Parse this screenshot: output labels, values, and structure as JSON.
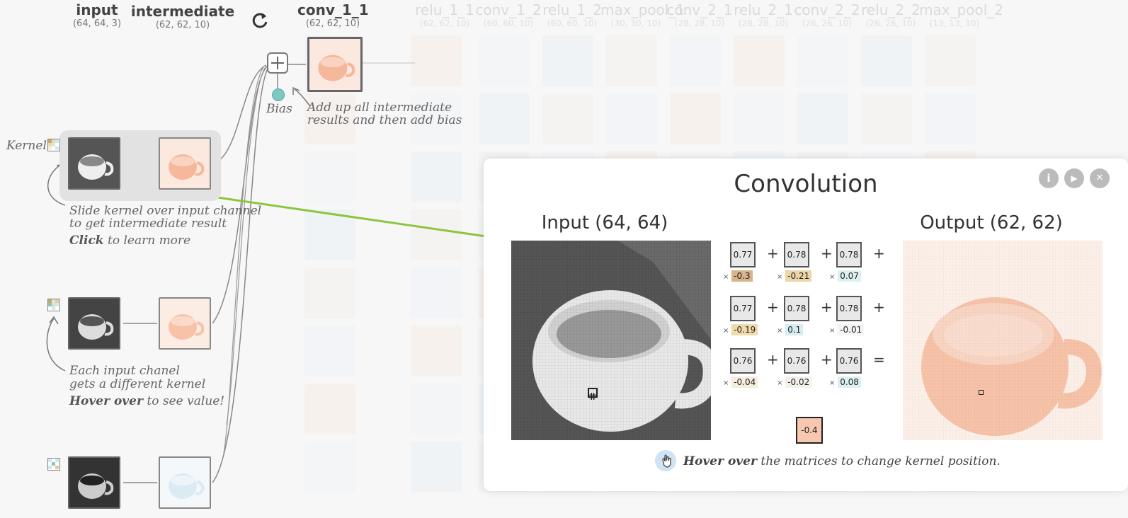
{
  "columns": {
    "input": {
      "name": "input",
      "shape": "(64, 64, 3)"
    },
    "intermediate": {
      "name": "intermediate",
      "shape": "(62, 62, 10)"
    },
    "conv_1_1": {
      "name": "conv_1_1",
      "shape": "(62, 62, 10)"
    }
  },
  "faded_columns": [
    {
      "name": "relu_1_1",
      "shape": "(62, 62, 10)"
    },
    {
      "name": "conv_1_2",
      "shape": "(60, 60, 10)"
    },
    {
      "name": "relu_1_2",
      "shape": "(60, 60, 10)"
    },
    {
      "name": "max_pool_1",
      "shape": "(30, 30, 10)"
    },
    {
      "name": "conv_2_1",
      "shape": "(28, 28, 10)"
    },
    {
      "name": "relu_2_1",
      "shape": "(28, 28, 10)"
    },
    {
      "name": "conv_2_2",
      "shape": "(26, 26, 10)"
    },
    {
      "name": "relu_2_2",
      "shape": "(26, 26, 10)"
    },
    {
      "name": "max_pool_2",
      "shape": "(13, 13, 10)"
    }
  ],
  "labels": {
    "kernel": "Kernel",
    "bias": "Bias",
    "add_note_1": "Add up all intermediate",
    "add_note_2": "results and then add bias",
    "slide_1": "Slide kernel over input channel",
    "slide_2": "to get intermediate result",
    "slide_3_bold": "Click",
    "slide_3_rest": " to learn more",
    "each_1": "Each input chanel",
    "each_2": "gets a different kernel",
    "each_3_bold": "Hover over",
    "each_3_rest": " to see value!"
  },
  "panel": {
    "title": "Convolution",
    "input_label": "Input (64, 64)",
    "output_label": "Output (62, 62)",
    "info_icon": "i",
    "play_icon": "▶",
    "close_icon": "✕",
    "hint_bold": "Hover over",
    "hint_rest": " the matrices to change kernel position.",
    "rows": [
      [
        {
          "v": "0.77",
          "w": "-0.3",
          "c": "#d9b48a"
        },
        {
          "v": "0.78",
          "w": "-0.21",
          "c": "#eed5a8"
        },
        {
          "v": "0.78",
          "w": "0.07",
          "c": "#ddf0f1"
        }
      ],
      [
        {
          "v": "0.77",
          "w": "-0.19",
          "c": "#f0dcaa"
        },
        {
          "v": "0.78",
          "w": "0.1",
          "c": "#d6eef0"
        },
        {
          "v": "0.78",
          "w": "-0.01",
          "c": "#f4f4f4"
        }
      ],
      [
        {
          "v": "0.76",
          "w": "-0.04",
          "c": "#f5eedd"
        },
        {
          "v": "0.76",
          "w": "-0.02",
          "c": "#f3f1ea"
        },
        {
          "v": "0.76",
          "w": "0.08",
          "c": "#dcf0f1"
        }
      ]
    ],
    "ops": [
      "+",
      "+",
      "+",
      "+",
      "+",
      "+",
      "+",
      "+",
      "="
    ],
    "mul": "×",
    "result": "-0.4"
  },
  "colors": {
    "accent_arrow": "#8cc63f",
    "bias_dot": "#7ec8c0",
    "output_tint": "#f7c2a8",
    "result_bg": "#f8c7b0"
  }
}
